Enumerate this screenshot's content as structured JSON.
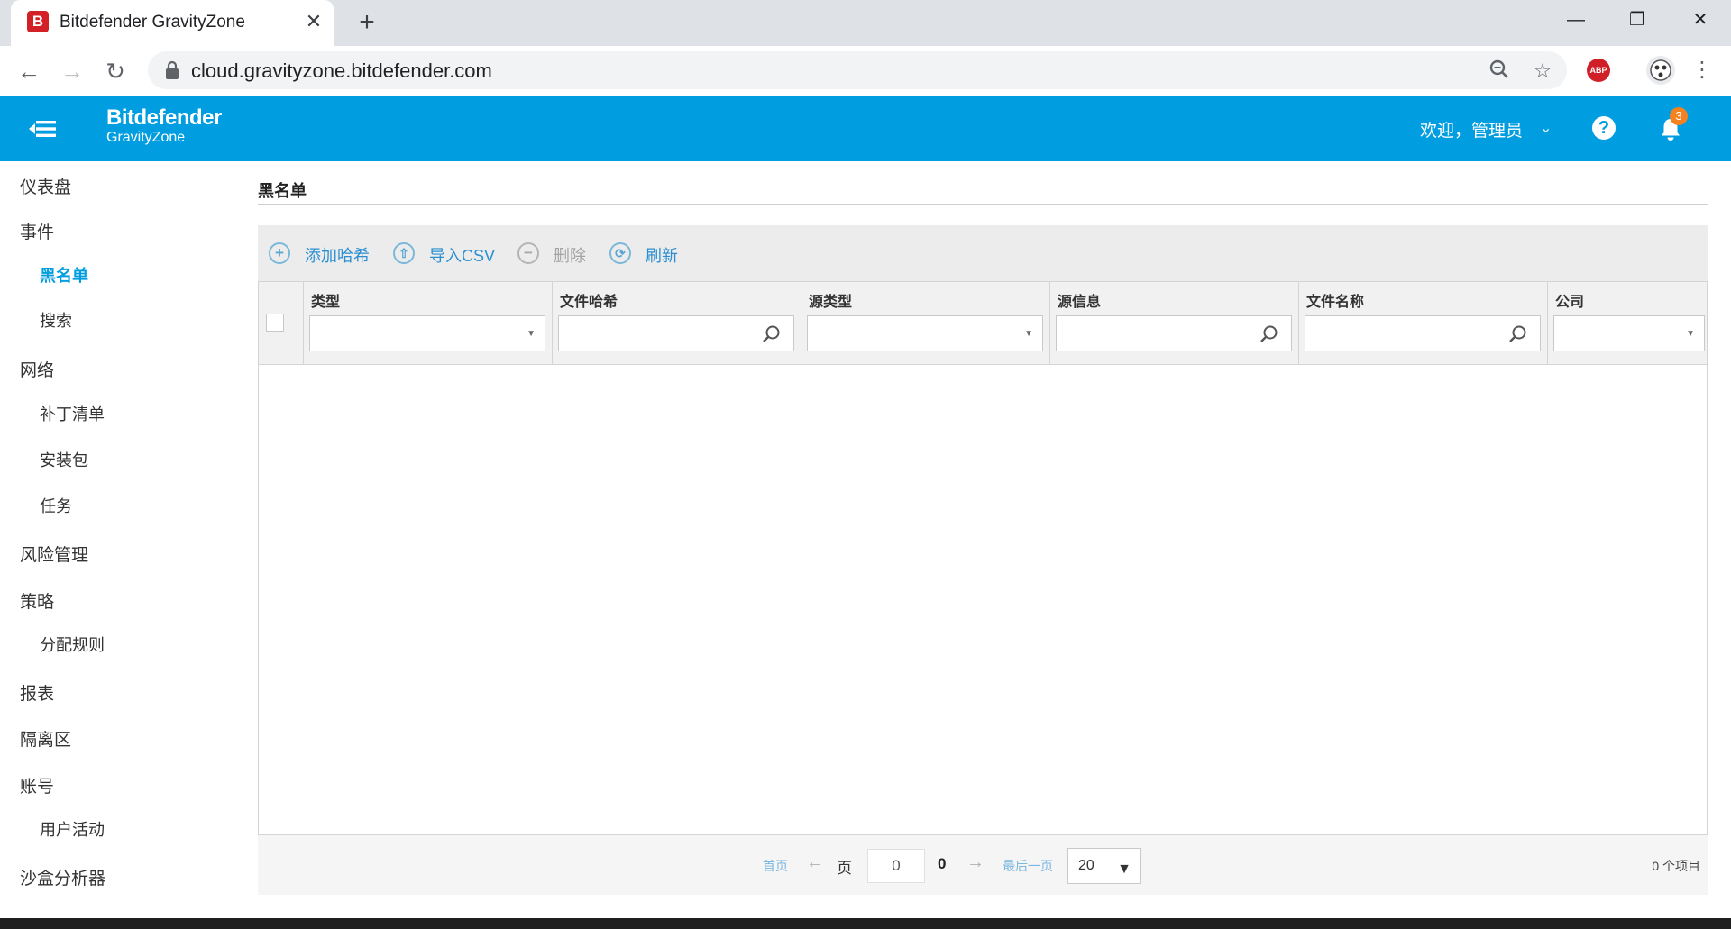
{
  "browser": {
    "tab_title": "Bitdefender GravityZone",
    "tab_favicon": "B",
    "url": "cloud.gravityzone.bitdefender.com",
    "abp_label": "ABP"
  },
  "header": {
    "brand_name": "Bitdefender",
    "brand_sub": "GravityZone",
    "welcome": "欢迎，管理员",
    "notification_count": "3",
    "color": "#009de0"
  },
  "sidebar": {
    "dashboard": "仪表盘",
    "incidents": "事件",
    "blacklist": "黑名单",
    "search": "搜索",
    "network": "网络",
    "patch_inventory": "补丁清单",
    "packages": "安装包",
    "tasks": "任务",
    "risk_management": "风险管理",
    "policies": "策略",
    "assignment_rules": "分配规则",
    "reports": "报表",
    "quarantine": "隔离区",
    "accounts": "账号",
    "user_activity": "用户活动",
    "sandbox_analyzer": "沙盒分析器"
  },
  "main": {
    "title": "黑名单",
    "actions": {
      "add_hash": "添加哈希",
      "import_csv": "导入CSV",
      "delete": "删除",
      "refresh": "刷新"
    },
    "columns": {
      "type": "类型",
      "file_hash": "文件哈希",
      "source_type": "源类型",
      "source_info": "源信息",
      "file_name": "文件名称",
      "company": "公司"
    }
  },
  "pager": {
    "first": "首页",
    "page_label": "页",
    "page_value": "0",
    "total_pages": "0",
    "last": "最后一页",
    "page_size": "20",
    "item_count": "0 个项目"
  }
}
